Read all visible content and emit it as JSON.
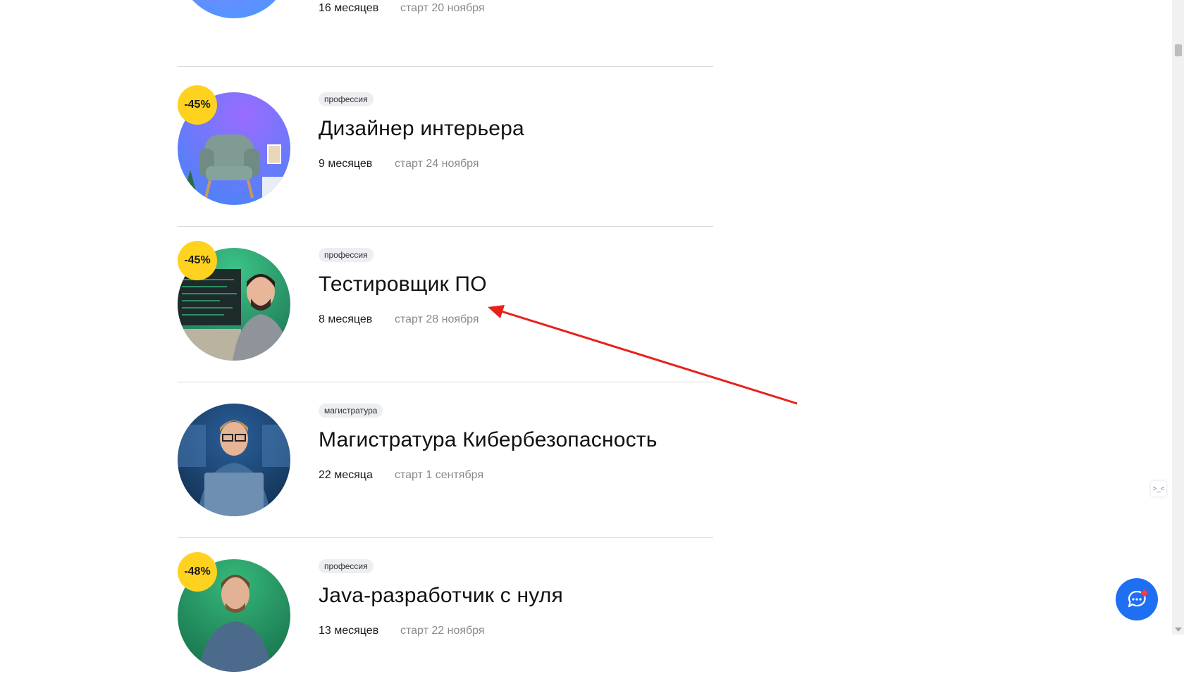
{
  "courses": [
    {
      "discount": "",
      "tag": "",
      "title": "",
      "duration": "16 месяцев",
      "start": "старт 20 ноября",
      "image": "laptop-illustration",
      "colors": {
        "bg1": "#a17cff",
        "bg2": "#3b9bff"
      }
    },
    {
      "discount": "-45%",
      "tag": "профессия",
      "title": "Дизайнер интерьера",
      "duration": "9 месяцев",
      "start": "старт 24 ноября",
      "image": "armchair-illustration",
      "colors": {
        "bg1": "#9a6cff",
        "bg2": "#3f86f5"
      }
    },
    {
      "discount": "-45%",
      "tag": "профессия",
      "title": "Тестировщик ПО",
      "duration": "8 месяцев",
      "start": "старт 28 ноября",
      "image": "man-with-monitor-photo",
      "colors": {
        "bg1": "#32b27a",
        "bg2": "#1b6b4d"
      }
    },
    {
      "discount": "",
      "tag": "магистратура",
      "title": "Магистратура Кибербезопасность",
      "duration": "22 месяца",
      "start": "старт 1 сентября",
      "image": "man-with-laptop-photo",
      "colors": {
        "bg1": "#2a5f9a",
        "bg2": "#0f2a48"
      }
    },
    {
      "discount": "-48%",
      "tag": "профессия",
      "title": "Java-разработчик с нуля",
      "duration": "13 месяцев",
      "start": "старт 22 ноября",
      "image": "man-portrait-photo",
      "colors": {
        "bg1": "#2fa56e",
        "bg2": "#156a48"
      }
    }
  ],
  "widgets": {
    "chat_icon": "chat-bubble-icon",
    "side_icon": "code-tag-icon",
    "side_glyph": ">_<"
  },
  "accent_colors": {
    "discount_badge": "#ffd21f",
    "chat_button": "#1f6ff2",
    "annotation_arrow": "#e8201c"
  }
}
